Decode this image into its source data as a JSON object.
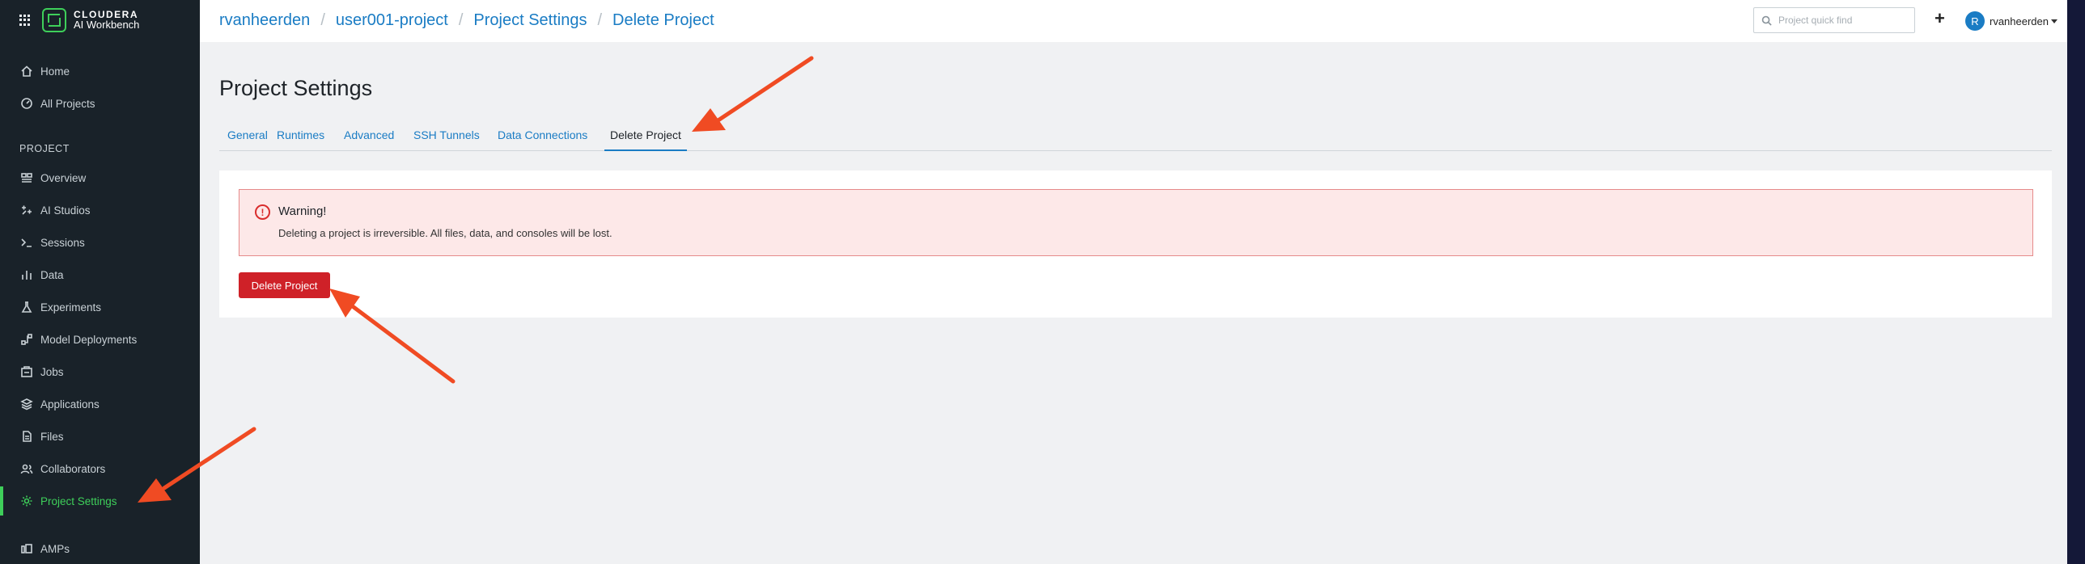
{
  "brand": {
    "line1": "CLOUDERA",
    "line2": "AI Workbench"
  },
  "sidebar": {
    "top_items": [
      {
        "label": "Home",
        "icon": "home-icon"
      },
      {
        "label": "All Projects",
        "icon": "gauge-icon"
      }
    ],
    "section_label": "PROJECT",
    "project_items": [
      {
        "label": "Overview",
        "icon": "overview-icon"
      },
      {
        "label": "AI Studios",
        "icon": "ai-studios-icon"
      },
      {
        "label": "Sessions",
        "icon": "terminal-icon"
      },
      {
        "label": "Data",
        "icon": "bar-chart-icon"
      },
      {
        "label": "Experiments",
        "icon": "flask-icon"
      },
      {
        "label": "Model Deployments",
        "icon": "model-icon"
      },
      {
        "label": "Jobs",
        "icon": "jobs-icon"
      },
      {
        "label": "Applications",
        "icon": "layers-icon"
      },
      {
        "label": "Files",
        "icon": "file-icon"
      },
      {
        "label": "Collaborators",
        "icon": "users-icon"
      },
      {
        "label": "Project Settings",
        "icon": "gear-icon",
        "active": true
      },
      {
        "label": "AMPs",
        "icon": "amps-icon"
      }
    ]
  },
  "header": {
    "breadcrumbs": [
      "rvanheerden",
      "user001-project",
      "Project Settings",
      "Delete Project"
    ],
    "search_placeholder": "Project quick find",
    "add_label": "+",
    "user_initial": "R",
    "username": "rvanheerden"
  },
  "main": {
    "title": "Project Settings",
    "tabs": [
      "General",
      "Runtimes",
      "Advanced",
      "SSH Tunnels",
      "Data Connections",
      "Delete Project"
    ],
    "active_tab": "Delete Project",
    "warning": {
      "title": "Warning!",
      "message": "Deleting a project is irreversible. All files, data, and consoles will be lost."
    },
    "delete_button_label": "Delete Project"
  },
  "colors": {
    "sidebar_bg": "#192229",
    "accent_green": "#3ecf5a",
    "link_blue": "#1a7cc4",
    "danger_red": "#cf2128",
    "annotation_arrow": "#f04b23"
  }
}
